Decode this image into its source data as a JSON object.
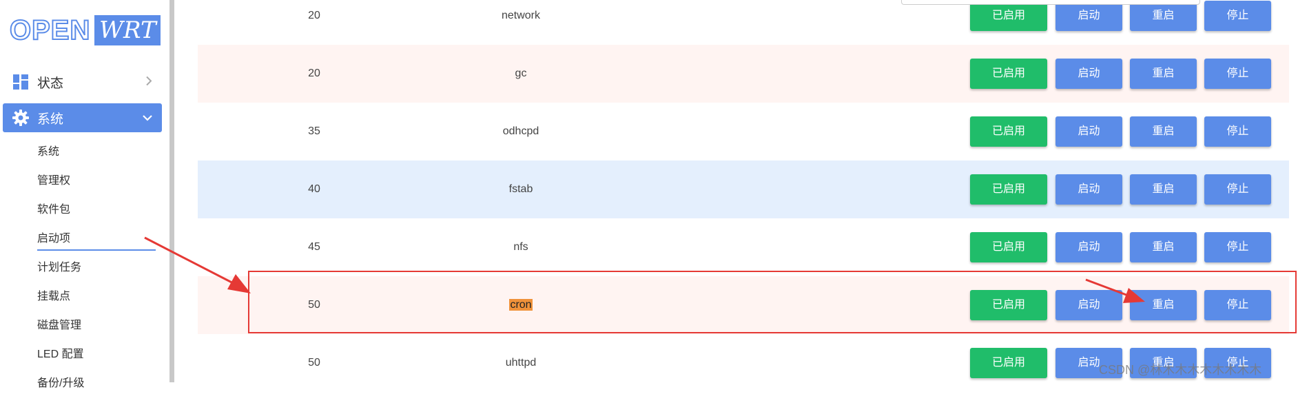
{
  "logo": {
    "part1": "OPEN",
    "part2": "WRT"
  },
  "sidebar": {
    "status_label": "状态",
    "system_label": "系统",
    "sub_items": [
      "系统",
      "管理权",
      "软件包",
      "启动项",
      "计划任务",
      "挂载点",
      "磁盘管理",
      "LED 配置",
      "备份/升级"
    ],
    "active_sub_item": "启动项"
  },
  "buttons": {
    "enabled": "已启用",
    "start": "启动",
    "restart": "重启",
    "stop": "停止"
  },
  "rows": [
    {
      "priority": "20",
      "name": "network"
    },
    {
      "priority": "20",
      "name": "gc"
    },
    {
      "priority": "35",
      "name": "odhcpd"
    },
    {
      "priority": "40",
      "name": "fstab"
    },
    {
      "priority": "45",
      "name": "nfs"
    },
    {
      "priority": "50",
      "name": "cron"
    },
    {
      "priority": "50",
      "name": "uhttpd"
    }
  ],
  "highlighted_row": "cron",
  "watermark": "CSDN @林木木木木木木木木",
  "colors": {
    "accent": "#5b8ce8",
    "enabled_green": "#20bd6a",
    "annotation_red": "#e53935",
    "search_highlight": "#f0923a"
  }
}
